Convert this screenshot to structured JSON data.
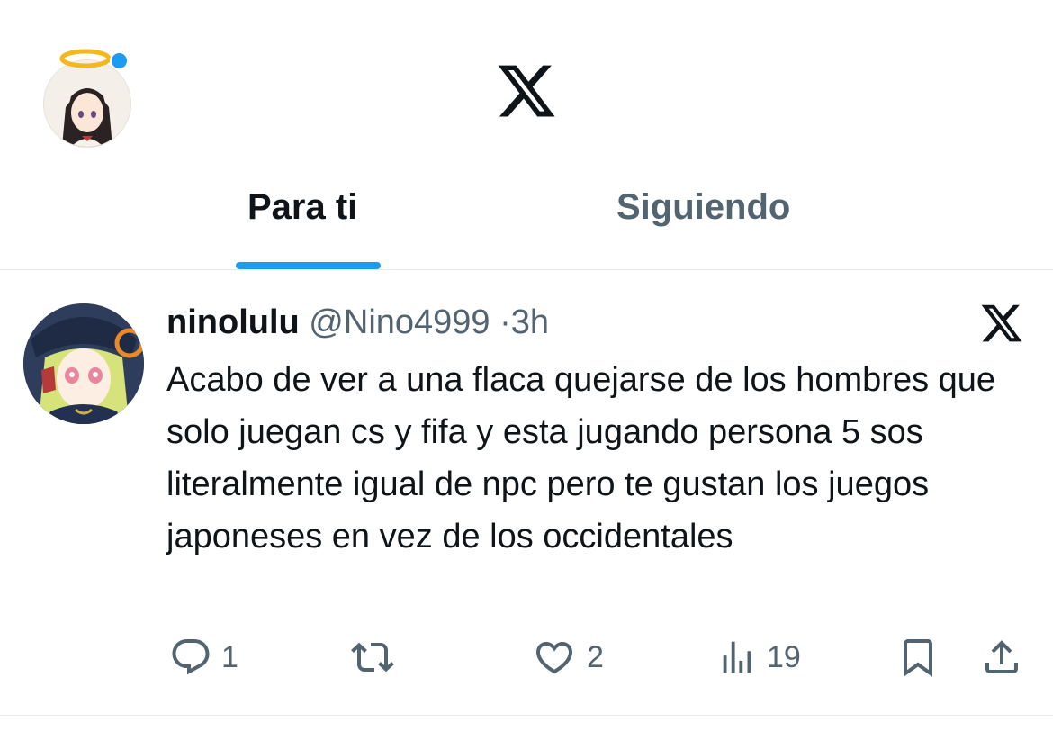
{
  "header": {
    "logo_icon": "x-logo-icon",
    "avatar_icon": "profile-avatar-icon",
    "tabs": [
      {
        "label": "Para ti",
        "active": true
      },
      {
        "label": "Siguiendo",
        "active": false
      }
    ],
    "accent_color": "#1d9bf0"
  },
  "tweet": {
    "display_name": "ninolulu",
    "handle": "@Nino4999",
    "separator": "·",
    "time": "3h",
    "text": "Acabo de ver a una flaca quejarse de los hombres que solo juegan cs y fifa y esta jugando persona 5 sos literalmente igual de npc pero te gustan los juegos japoneses en vez de los occidentales",
    "grok_icon": "x-grok-icon",
    "actions": {
      "reply": {
        "icon": "reply-icon",
        "count": "1"
      },
      "retweet": {
        "icon": "retweet-icon"
      },
      "like": {
        "icon": "heart-icon",
        "count": "2"
      },
      "views": {
        "icon": "views-chart-icon",
        "count": "19"
      },
      "bookmark": {
        "icon": "bookmark-icon"
      },
      "share": {
        "icon": "share-icon"
      }
    }
  }
}
